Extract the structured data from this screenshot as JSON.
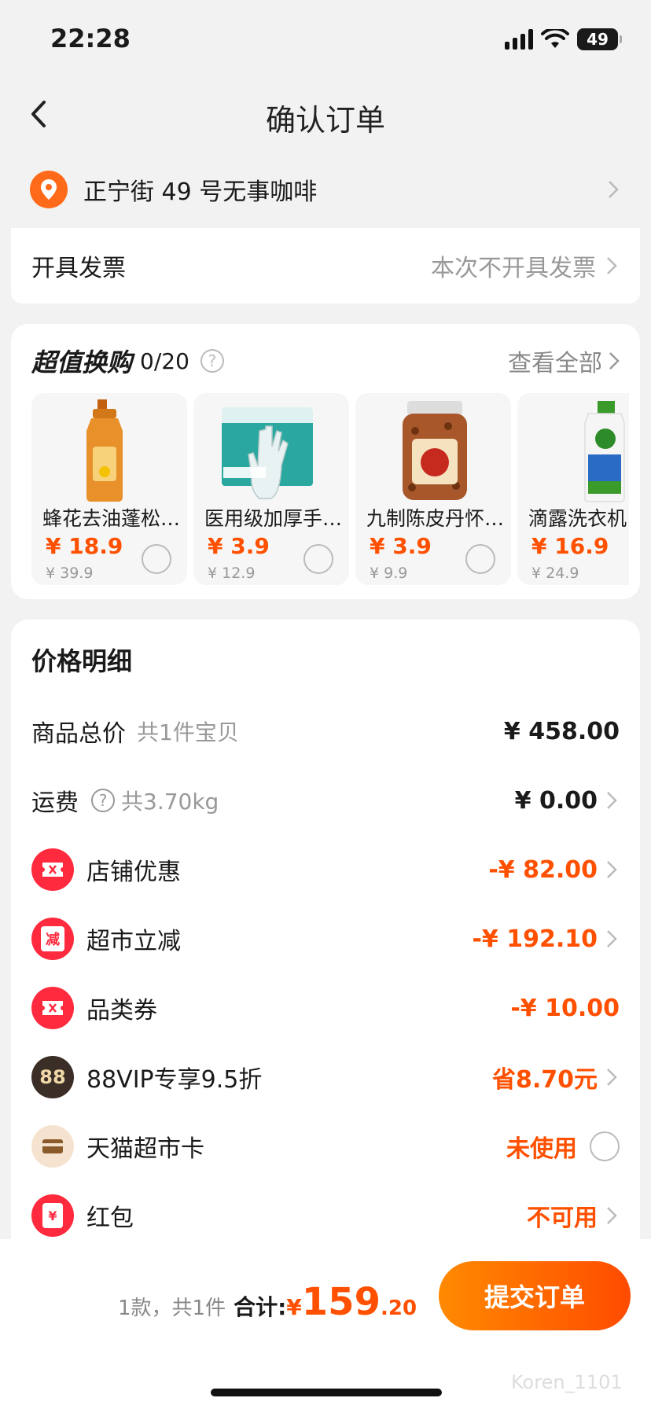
{
  "status": {
    "time": "22:28",
    "battery": "49"
  },
  "nav": {
    "title": "确认订单"
  },
  "address": {
    "text": "正宁街 49 号无事咖啡"
  },
  "invoice": {
    "label": "开具发票",
    "value": "本次不开具发票"
  },
  "exchange": {
    "title": "超值换购",
    "count": "0/20",
    "help": "?",
    "view_all": "查看全部",
    "products": [
      {
        "name": "蜂花去油蓬松…",
        "price": "¥ 18.9",
        "original": "¥ 39.9",
        "image": "shampoo-bottle"
      },
      {
        "name": "医用级加厚手…",
        "price": "¥ 3.9",
        "original": "¥ 12.9",
        "image": "glove-box"
      },
      {
        "name": "九制陈皮丹怀…",
        "price": "¥ 3.9",
        "original": "¥ 9.9",
        "image": "candy-jar"
      },
      {
        "name": "滴露洗衣机",
        "price": "¥ 16.9",
        "original": "¥ 24.9",
        "image": "disinfectant-bottle"
      }
    ]
  },
  "price_detail": {
    "title": "价格明细",
    "rows": [
      {
        "label": "商品总价",
        "sub": "共1件宝贝",
        "value": "¥ 458.00"
      },
      {
        "label": "运费",
        "sub": "共3.70kg",
        "value": "¥ 0.00",
        "help": "?"
      },
      {
        "label": "店铺优惠",
        "value": "-¥ 82.00",
        "icon": "ticket-icon"
      },
      {
        "label": "超市立减",
        "value": "-¥ 192.10",
        "icon": "reduce-icon",
        "icon_text": "减"
      },
      {
        "label": "品类券",
        "value": "-¥ 10.00",
        "icon": "ticket-icon"
      },
      {
        "label": "88VIP专享9.5折",
        "value": "省8.70元",
        "icon": "vip-icon",
        "icon_text": "88"
      },
      {
        "label": "天猫超市卡",
        "value": "未使用",
        "icon": "card-icon"
      },
      {
        "label": "红包",
        "value": "不可用",
        "icon": "red-packet-icon",
        "icon_text": "¥"
      }
    ]
  },
  "bottom": {
    "qty": "1款，共1件",
    "total_label": "合计:",
    "currency": "¥",
    "total_int": "159",
    "total_dec": ".20",
    "submit": "提交订单",
    "watermark": "Koren_1101"
  },
  "colors": {
    "accent": "#ff5000",
    "button_start": "#ff8a00",
    "button_end": "#ff4b00",
    "red_icon": "#ff2a3d"
  }
}
